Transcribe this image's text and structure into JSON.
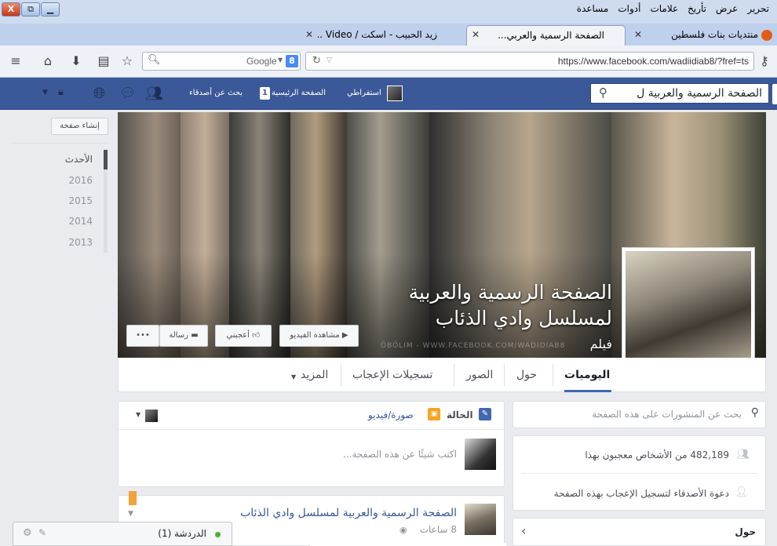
{
  "window": {
    "close": "X",
    "max": "⧉",
    "min": "▁"
  },
  "menu": {
    "items": [
      "تحرير",
      "عرض",
      "تأريخ",
      "علامات",
      "أدوات",
      "مساعدة"
    ]
  },
  "tabs": [
    {
      "label": "منتديات بنات فلسطين"
    },
    {
      "label": "الصفحة الرسمية والعربي..."
    },
    {
      "label": "زيد الحبيب - اسكت / Video ..."
    }
  ],
  "toolbar": {
    "search_engine": "Google",
    "search_badge": "8",
    "url": "https://www.facebook.com/wadiidiab8/?fref=ts"
  },
  "fb": {
    "search_value": "الصفحة الرسمية والعربية ل",
    "profile_name": "استفراطي",
    "home_label": "الصفحة الرئيسية",
    "home_count": "1",
    "find_friends": "بحث عن أصدقاء"
  },
  "sidebar": {
    "build_page": "إنشاء صفحة",
    "years": [
      "الأحدث",
      "2016",
      "2015",
      "2014",
      "2013"
    ]
  },
  "cover": {
    "title_line1": "الصفحة الرسمية والعربية",
    "title_line2": "لمسلسل وادي الذئاب",
    "category": "فيلم",
    "watermark": "ÖBÖLIM - WWW.FACEBOOK.COM/WADIDIAB8",
    "btn_watch": "مشاهدة الفيديو",
    "btn_like": "أعجبني",
    "btn_message": "رسالة",
    "btn_more": "•••"
  },
  "pagenav": {
    "items": [
      "اليوميات",
      "حول",
      "الصور",
      "تسجيلات الإعجاب",
      "المزيد"
    ]
  },
  "composer": {
    "status": "الحالة",
    "photo": "صورة/فيديو",
    "placeholder": "اكتب شيئًا عن هذه الصفحة..."
  },
  "post": {
    "author": "الصفحة الرسمية والعربية لمسلسل وادي الذئاب",
    "time": "8 ساعات"
  },
  "right": {
    "search_placeholder": "بحث عن المنشورات على هذه الصفحة",
    "likes": "482,189 من الأشخاص معجبون بهذا",
    "invite": "دعوة الأصدقاء لتسجيل الإعجاب بهذه الصفحة",
    "about": "حول"
  },
  "chat": {
    "label": "الدردشة (1)"
  },
  "colors": {
    "fb_blue": "#3b5998",
    "link": "#365899"
  }
}
